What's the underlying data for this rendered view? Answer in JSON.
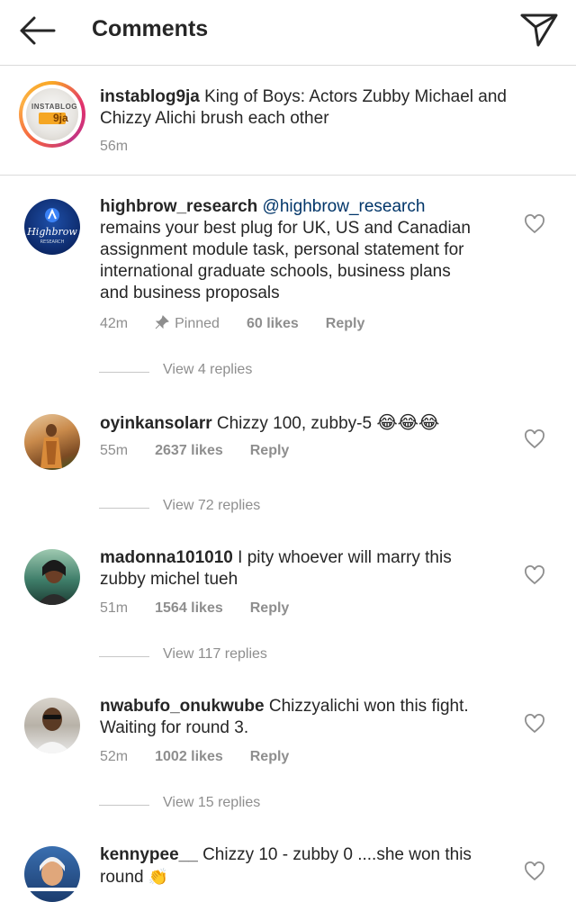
{
  "header": {
    "title": "Comments"
  },
  "caption": {
    "username": "instablog9ja",
    "text": " King of Boys: Actors Zubby Michael and",
    "text2": "Chizzy Alichi brush each other",
    "time": "56m",
    "avatar_text": "INSTABLOG",
    "avatar_text2": "9ja"
  },
  "comments": [
    {
      "username": "highbrow_research",
      "mention": " @highbrow_research",
      "lines": [
        "remains your best plug for UK, US and Canadian",
        "assignment module task, personal statement for",
        "international graduate schools, business plans",
        "and business proposals"
      ],
      "time": "42m",
      "pinned": "Pinned",
      "likes": "60 likes",
      "reply": "Reply",
      "view_replies": "View 4 replies"
    },
    {
      "username": "oyinkansolarr",
      "text": " Chizzy 100, zubby-5 ",
      "emoji": "😂😂😂",
      "time": "55m",
      "likes": "2637 likes",
      "reply": "Reply",
      "view_replies": "View 72 replies"
    },
    {
      "username": "madonna101010",
      "text": " I pity whoever will marry this",
      "text2": "zubby michel tueh",
      "time": "51m",
      "likes": "1564 likes",
      "reply": "Reply",
      "view_replies": "View 117 replies"
    },
    {
      "username": "nwabufo_onukwube",
      "text": " Chizzyalichi won this fight.",
      "text2": "Waiting for round 3.",
      "time": "52m",
      "likes": "1002 likes",
      "reply": "Reply",
      "view_replies": "View 15 replies"
    },
    {
      "username": "kennypee__",
      "text": " Chizzy 10 - zubby 0 ....she won this",
      "text2": "round ",
      "emoji": "👏"
    }
  ],
  "colors": {
    "username_text": "#262626",
    "mention": "#003569",
    "meta": "#8e8e8e",
    "divider": "#dbdbdb"
  },
  "icons": {
    "back": "arrow-left-icon",
    "share": "paper-plane-icon",
    "like": "heart-outline-icon",
    "pin": "pin-icon"
  }
}
